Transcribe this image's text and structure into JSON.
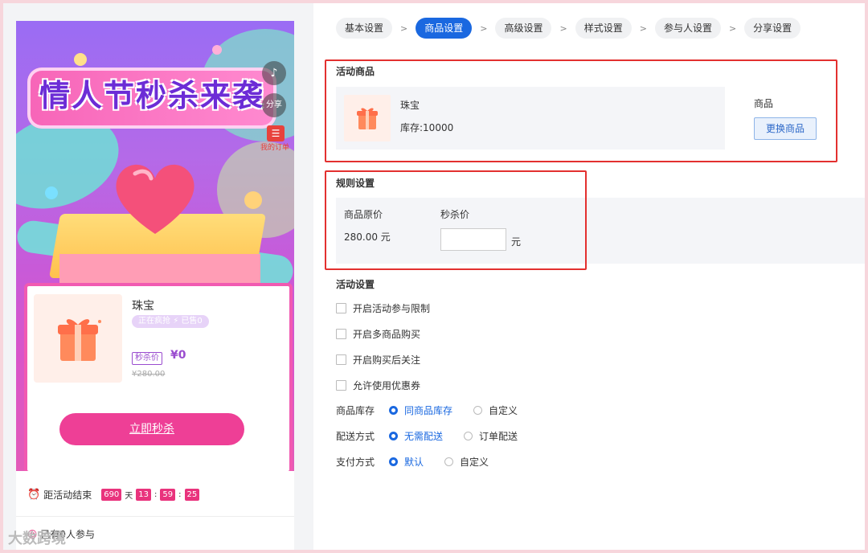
{
  "preview": {
    "poster_title": "情人节秒杀来袭",
    "music_icon_glyph": "♪",
    "share_label": "分享",
    "my_order_label": "我的订单",
    "product": {
      "name": "珠宝",
      "tag_status": "正在疯抢",
      "tag_sold": "已售0",
      "price_tag": "秒杀价",
      "price": "¥0",
      "old_price": "¥280.00"
    },
    "buy_button": "立即秒杀",
    "countdown": {
      "label": "距活动结束",
      "days": "690",
      "day_unit": "天",
      "hours": "13",
      "minutes": "59",
      "seconds": "25",
      "sep": ":"
    },
    "participants": "已有0人参与",
    "watermark": "大数跨境"
  },
  "steps": [
    "基本设置",
    "商品设置",
    "高级设置",
    "样式设置",
    "参与人设置",
    "分享设置"
  ],
  "step_arrow": ">",
  "active_step": "商品设置",
  "activity_goods": {
    "title": "活动商品",
    "name": "珠宝",
    "stock": "库存:10000",
    "goods_label": "商品",
    "change_button": "更换商品"
  },
  "rules": {
    "title": "规则设置",
    "original_price_label": "商品原价",
    "seckill_price_label": "秒杀价",
    "original_price_value": "280.00 元",
    "seckill_price_value": "",
    "unit": "元"
  },
  "activity_settings": {
    "title": "活动设置",
    "checkboxes": [
      "开启活动参与限制",
      "开启多商品购买",
      "开启购买后关注",
      "允许使用优惠券"
    ],
    "stock": {
      "label": "商品库存",
      "opt_on": "同商品库存",
      "opt_off": "自定义"
    },
    "delivery": {
      "label": "配送方式",
      "opt_on": "无需配送",
      "opt_off": "订单配送"
    },
    "payment": {
      "label": "支付方式",
      "opt_on": "默认",
      "opt_off": "自定义"
    }
  },
  "colors": {
    "primary": "#1a68e0",
    "highlight_border": "#e3302f",
    "buy_button": "#ee3f96"
  }
}
